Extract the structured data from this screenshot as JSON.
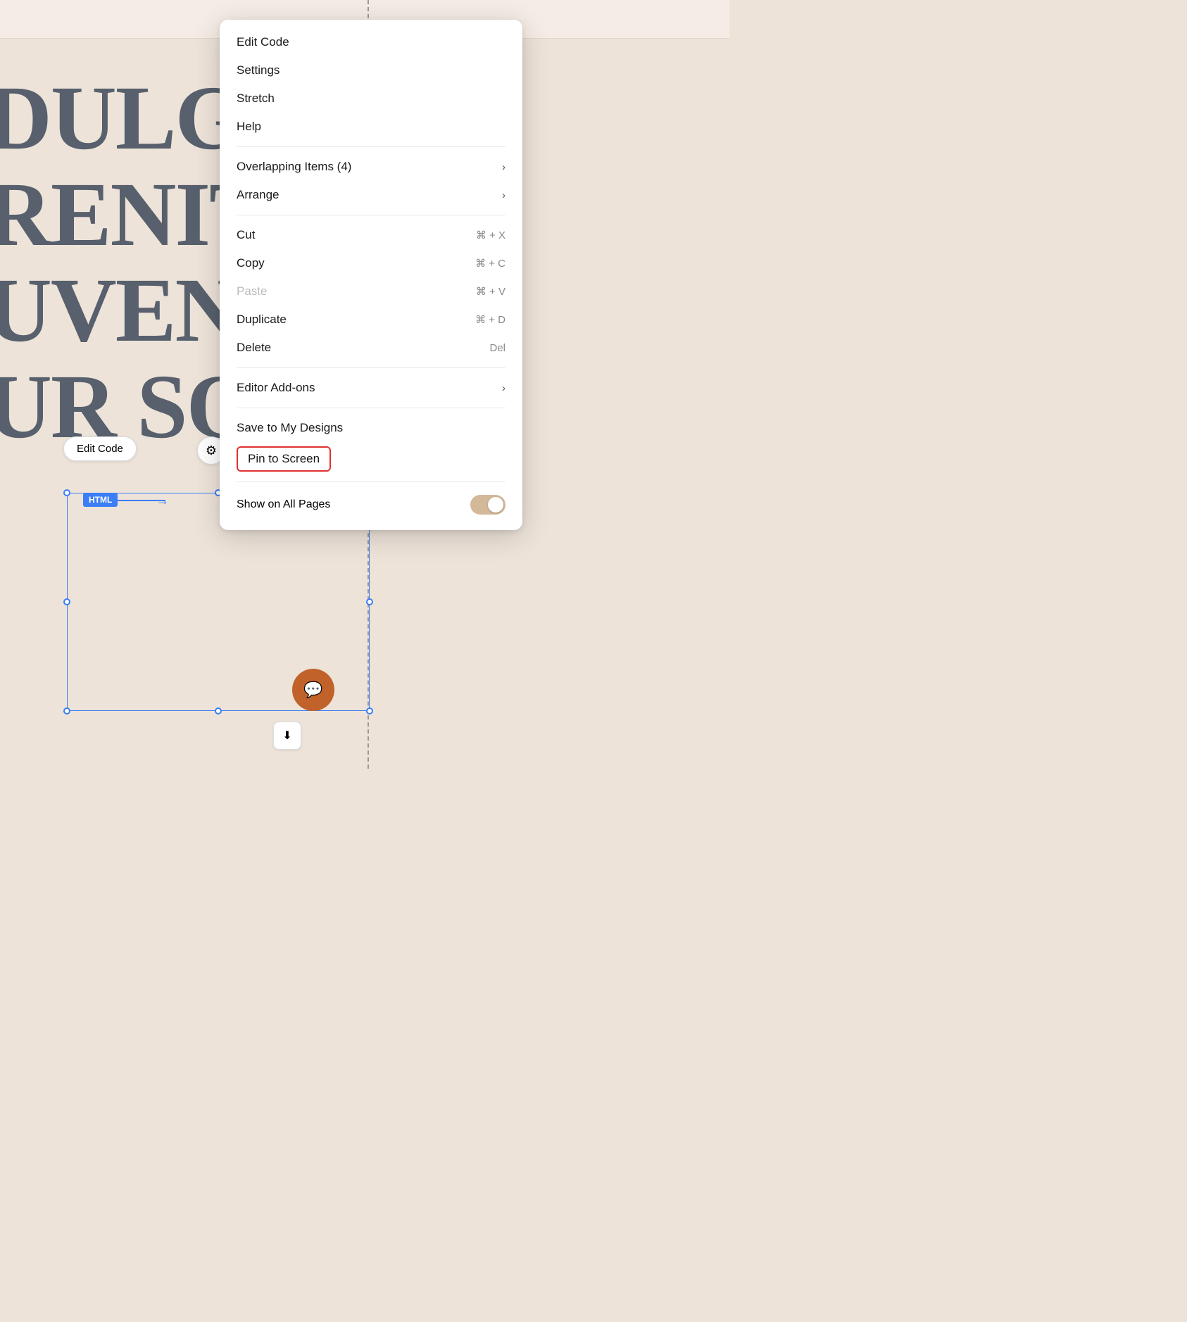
{
  "canvas": {
    "bg_color": "#ede3d9",
    "bg_text_lines": [
      "DULGE I",
      "RENITY",
      "UVENAT",
      "UR SOU"
    ]
  },
  "toolbar": {
    "edit_code_label": "Edit Code",
    "html_badge": "HTML"
  },
  "context_menu": {
    "items": [
      {
        "id": "edit-code",
        "label": "Edit Code",
        "shortcut": "",
        "arrow": false,
        "disabled": false
      },
      {
        "id": "settings",
        "label": "Settings",
        "shortcut": "",
        "arrow": false,
        "disabled": false
      },
      {
        "id": "stretch",
        "label": "Stretch",
        "shortcut": "",
        "arrow": false,
        "disabled": false
      },
      {
        "id": "help",
        "label": "Help",
        "shortcut": "",
        "arrow": false,
        "disabled": false
      },
      {
        "id": "overlapping",
        "label": "Overlapping Items (4)",
        "shortcut": "",
        "arrow": true,
        "disabled": false
      },
      {
        "id": "arrange",
        "label": "Arrange",
        "shortcut": "",
        "arrow": true,
        "disabled": false
      },
      {
        "id": "cut",
        "label": "Cut",
        "shortcut": "⌘ + X",
        "arrow": false,
        "disabled": false
      },
      {
        "id": "copy",
        "label": "Copy",
        "shortcut": "⌘ + C",
        "arrow": false,
        "disabled": false
      },
      {
        "id": "paste",
        "label": "Paste",
        "shortcut": "⌘ + V",
        "arrow": false,
        "disabled": true
      },
      {
        "id": "duplicate",
        "label": "Duplicate",
        "shortcut": "⌘ + D",
        "arrow": false,
        "disabled": false
      },
      {
        "id": "delete",
        "label": "Delete",
        "shortcut": "Del",
        "arrow": false,
        "disabled": false
      },
      {
        "id": "editor-addons",
        "label": "Editor Add-ons",
        "shortcut": "",
        "arrow": true,
        "disabled": false
      },
      {
        "id": "save-designs",
        "label": "Save to My Designs",
        "shortcut": "",
        "arrow": false,
        "disabled": false
      },
      {
        "id": "pin-to-screen",
        "label": "Pin to Screen",
        "shortcut": "",
        "arrow": false,
        "disabled": false,
        "highlighted": true
      },
      {
        "id": "show-all-pages",
        "label": "Show on All Pages",
        "shortcut": "",
        "arrow": false,
        "disabled": false,
        "toggle": true,
        "toggle_on": true
      }
    ],
    "dividers_after": [
      "help",
      "arrange",
      "delete",
      "editor-addons",
      "pin-to-screen"
    ]
  }
}
